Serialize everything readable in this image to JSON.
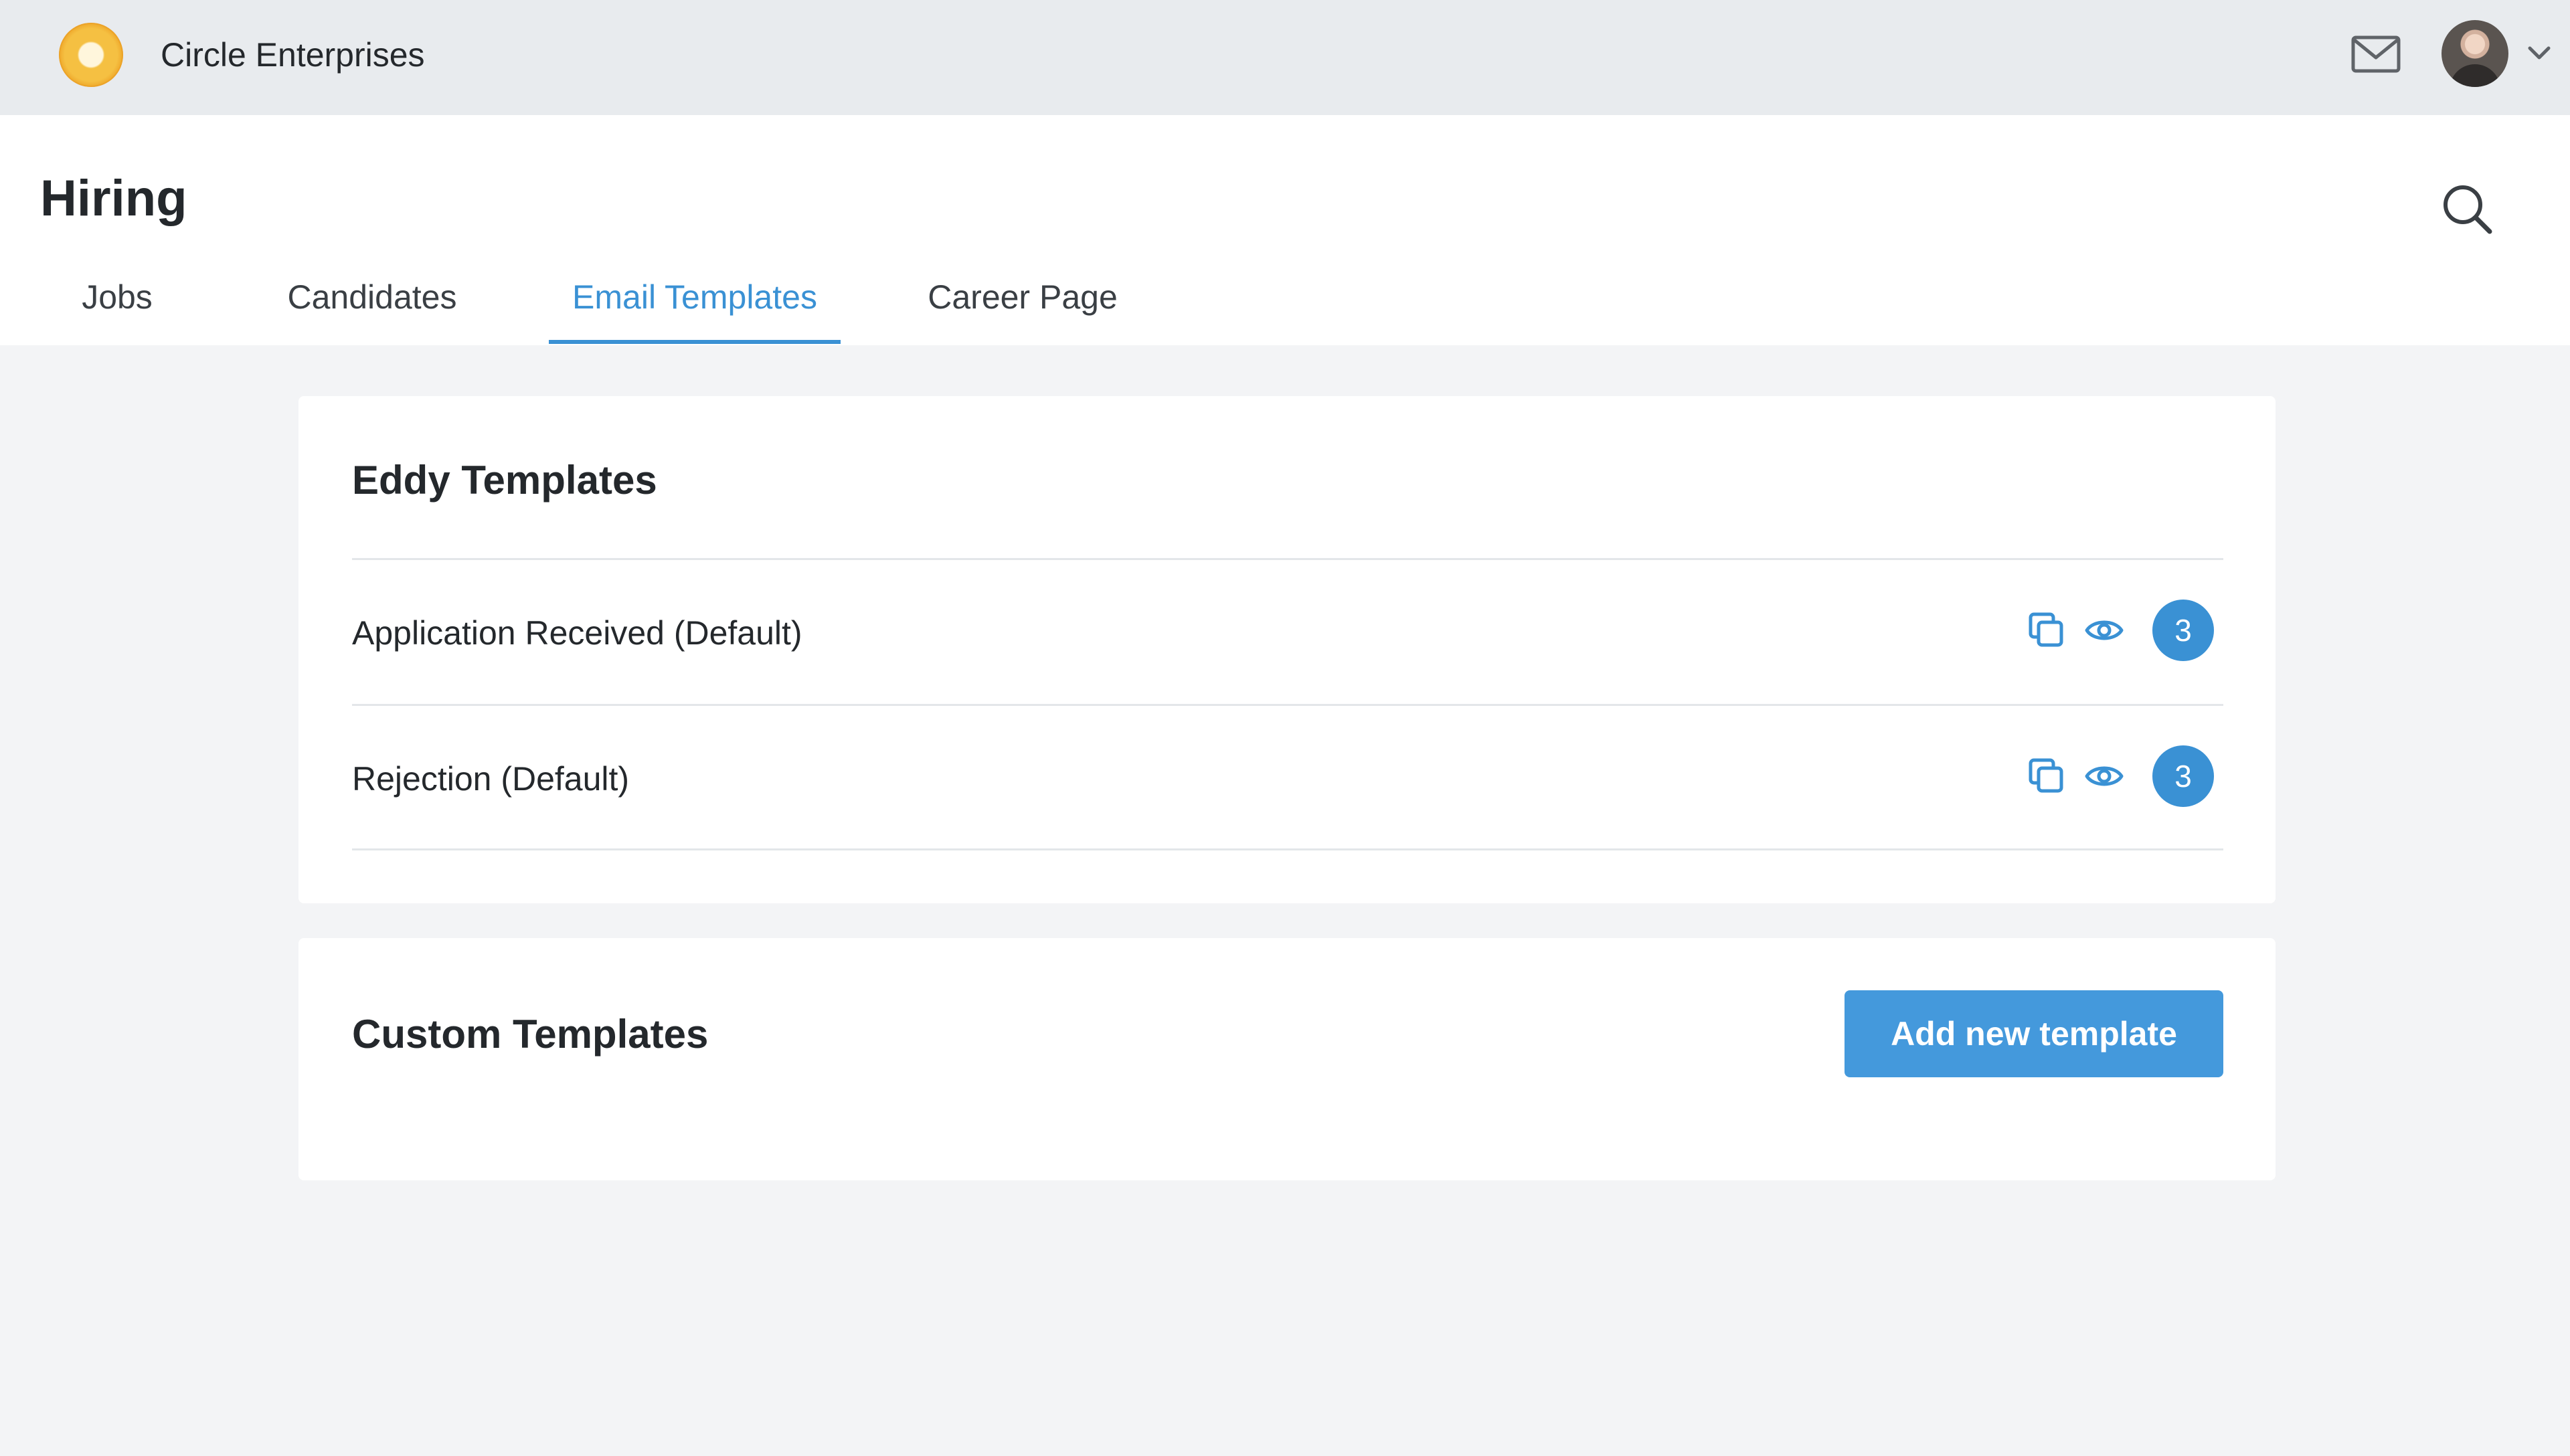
{
  "topbar": {
    "company_name": "Circle Enterprises",
    "icons": [
      "logo",
      "mail-icon",
      "avatar",
      "chevron-down-icon"
    ]
  },
  "header": {
    "title": "Hiring",
    "search_icon": "search-icon",
    "tabs": [
      {
        "label": "Jobs",
        "active": false
      },
      {
        "label": "Candidates",
        "active": false
      },
      {
        "label": "Email Templates",
        "active": true
      },
      {
        "label": "Career Page",
        "active": false
      }
    ]
  },
  "eddy_templates": {
    "title": "Eddy Templates",
    "items": [
      {
        "label": "Application Received (Default)",
        "count": "3",
        "actions": [
          "copy-icon",
          "eye-icon"
        ]
      },
      {
        "label": "Rejection (Default)",
        "count": "3",
        "actions": [
          "copy-icon",
          "eye-icon"
        ]
      }
    ]
  },
  "custom_templates": {
    "title": "Custom Templates",
    "add_button_label": "Add new template"
  },
  "colors": {
    "accent": "#3a91d4",
    "button": "#4499dc",
    "topbar_bg": "#e8ebee",
    "page_bg": "#f3f4f6"
  }
}
